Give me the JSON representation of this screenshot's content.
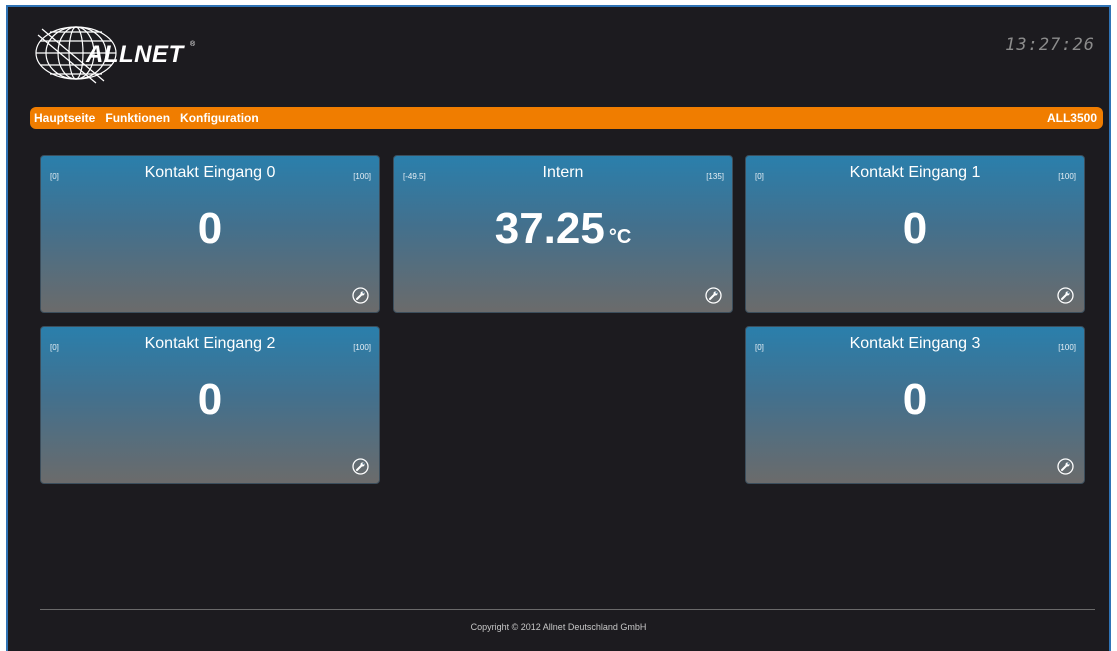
{
  "header": {
    "brand": "ALLNET",
    "brand_mark": "®",
    "clock": "13:27:26"
  },
  "menu": {
    "items": [
      "Hauptseite",
      "Funktionen",
      "Konfiguration"
    ],
    "model": "ALL3500"
  },
  "tiles": [
    {
      "title": "Kontakt Eingang 0",
      "min": "[0]",
      "max": "[100]",
      "value": "0",
      "unit": ""
    },
    {
      "title": "Intern",
      "min": "[-49.5]",
      "max": "[135]",
      "value": "37.25",
      "unit": "°C"
    },
    {
      "title": "Kontakt Eingang 1",
      "min": "[0]",
      "max": "[100]",
      "value": "0",
      "unit": ""
    },
    {
      "title": "Kontakt Eingang 2",
      "min": "[0]",
      "max": "[100]",
      "value": "0",
      "unit": ""
    },
    {
      "title": "Kontakt Eingang 3",
      "min": "[0]",
      "max": "[100]",
      "value": "0",
      "unit": ""
    }
  ],
  "footer": {
    "copyright": "Copyright © 2012 Allnet Deutschland GmbH"
  },
  "icons": {
    "settings": "wrench-icon",
    "logo": "globe-icon"
  }
}
